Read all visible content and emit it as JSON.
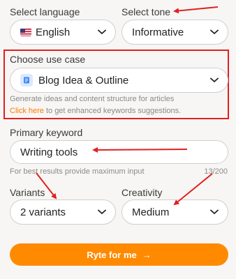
{
  "language": {
    "label": "Select language",
    "value": "English"
  },
  "tone": {
    "label": "Select tone",
    "value": "Informative"
  },
  "use_case": {
    "label": "Choose use case",
    "value": "Blog Idea & Outline",
    "description": "Generate ideas and content structure for articles",
    "link_text": "Click here",
    "link_suffix": " to get enhanced keywords suggestions."
  },
  "keyword": {
    "label": "Primary keyword",
    "value": "Writing tools",
    "hint": "For best results provide maximum input",
    "counter": "13/200"
  },
  "variants": {
    "label": "Variants",
    "value": "2 variants"
  },
  "creativity": {
    "label": "Creativity",
    "value": "Medium"
  },
  "cta": {
    "label": "Ryte for me",
    "arrow": "→"
  },
  "colors": {
    "accent": "#ff8a00",
    "annotation": "#e02020",
    "link": "#ff7a00"
  }
}
